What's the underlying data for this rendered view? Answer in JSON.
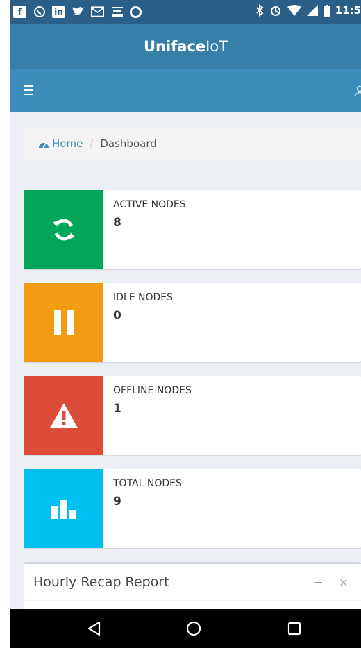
{
  "status_bar": {
    "left_icons": [
      "facebook-icon",
      "whatsapp-icon",
      "linkedin-icon",
      "twitter-icon",
      "gmail-icon",
      "tray-icon",
      "ring-icon"
    ],
    "time": "11:5"
  },
  "header": {
    "brand_bold": "Uniface",
    "brand_light": "IoT"
  },
  "breadcrumb": {
    "home": "Home",
    "separator": "/",
    "current": "Dashboard"
  },
  "info_boxes": [
    {
      "label": "ACTIVE NODES",
      "value": "8",
      "color": "#00a65a",
      "icon": "refresh-icon"
    },
    {
      "label": "IDLE NODES",
      "value": "0",
      "color": "#f39c12",
      "icon": "pause-icon"
    },
    {
      "label": "OFFLINE NODES",
      "value": "1",
      "color": "#dd4b39",
      "icon": "warning-icon"
    },
    {
      "label": "TOTAL NODES",
      "value": "9",
      "color": "#00c0ef",
      "icon": "bar-chart-icon"
    }
  ],
  "recap": {
    "title": "Hourly Recap Report",
    "collapse": "−",
    "close": "×"
  },
  "colors": {
    "primary": "#3c8dbc",
    "logo_bg": "#367fa9",
    "content_bg": "#ecf0f5"
  }
}
